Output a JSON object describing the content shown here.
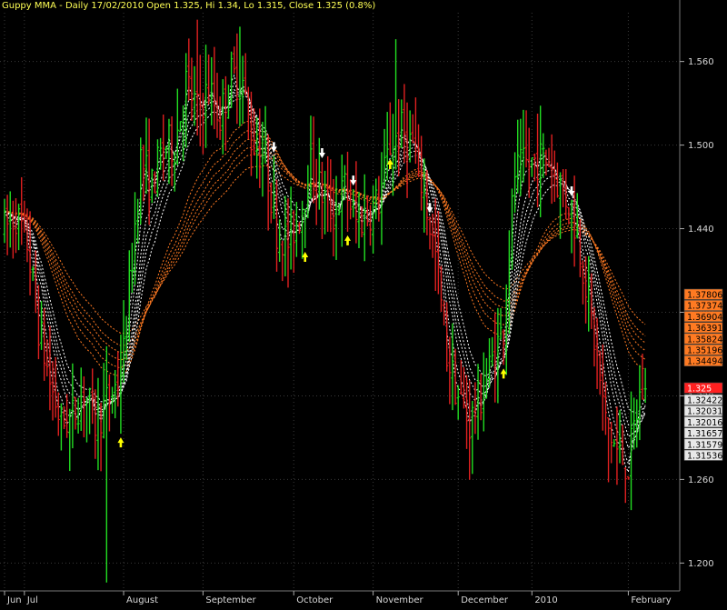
{
  "header": {
    "title": "Guppy MMA - Daily 17/02/2010 Open 1.325, Hi 1.34, Lo 1.315, Close 1.325 (0.8%)"
  },
  "colors": {
    "background": "#000000",
    "up_bar": "#22dd22",
    "down_bar": "#e02020",
    "short_ema": "#ffffff",
    "long_ema": "#ff7a22",
    "buy_arrow": "#ffff00",
    "sell_arrow": "#ffffff",
    "grid": "#3a3a3a",
    "long_label_bg": "#ff7a22",
    "short_label_bg": "#e8e8e8",
    "price_label_bg": "#ff2020"
  },
  "chart_data": {
    "type": "ohlc",
    "title": "Guppy MMA - Daily 17/02/2010 Open 1.325, Hi 1.34, Lo 1.315, Close 1.325 (0.8%)",
    "xlabel": "",
    "ylabel": "",
    "ylim": [
      1.18,
      1.595
    ],
    "y_ticks": [
      1.2,
      1.26,
      1.32,
      1.38,
      1.44,
      1.5,
      1.56
    ],
    "y_tick_labels": [
      "1.200",
      "1.260",
      "1.320",
      "1.380",
      "1.440",
      "1.500",
      "1.560"
    ],
    "x_tick_labels": [
      "Jun",
      "Jul",
      "August",
      "September",
      "October",
      "November",
      "December",
      "2010",
      "February"
    ],
    "x_tick_label_days": [
      0,
      7,
      42,
      70,
      102,
      130,
      160,
      186,
      220
    ],
    "grid": true,
    "trend_points": [
      [
        0,
        1.44
      ],
      [
        4,
        1.45
      ],
      [
        8,
        1.43
      ],
      [
        12,
        1.37
      ],
      [
        16,
        1.33
      ],
      [
        20,
        1.3
      ],
      [
        24,
        1.305
      ],
      [
        28,
        1.325
      ],
      [
        32,
        1.3
      ],
      [
        36,
        1.315
      ],
      [
        40,
        1.33
      ],
      [
        42,
        1.35
      ],
      [
        45,
        1.42
      ],
      [
        48,
        1.49
      ],
      [
        52,
        1.47
      ],
      [
        56,
        1.5
      ],
      [
        60,
        1.5
      ],
      [
        64,
        1.545
      ],
      [
        68,
        1.525
      ],
      [
        72,
        1.54
      ],
      [
        76,
        1.52
      ],
      [
        80,
        1.55
      ],
      [
        84,
        1.545
      ],
      [
        87,
        1.505
      ],
      [
        92,
        1.49
      ],
      [
        96,
        1.44
      ],
      [
        100,
        1.43
      ],
      [
        104,
        1.45
      ],
      [
        108,
        1.485
      ],
      [
        112,
        1.465
      ],
      [
        116,
        1.45
      ],
      [
        120,
        1.47
      ],
      [
        124,
        1.445
      ],
      [
        128,
        1.45
      ],
      [
        132,
        1.46
      ],
      [
        136,
        1.5
      ],
      [
        140,
        1.51
      ],
      [
        144,
        1.5
      ],
      [
        148,
        1.465
      ],
      [
        152,
        1.42
      ],
      [
        156,
        1.35
      ],
      [
        160,
        1.32
      ],
      [
        164,
        1.3
      ],
      [
        168,
        1.32
      ],
      [
        172,
        1.345
      ],
      [
        176,
        1.37
      ],
      [
        180,
        1.48
      ],
      [
        184,
        1.485
      ],
      [
        188,
        1.49
      ],
      [
        192,
        1.49
      ],
      [
        196,
        1.47
      ],
      [
        200,
        1.455
      ],
      [
        204,
        1.415
      ],
      [
        208,
        1.36
      ],
      [
        212,
        1.3
      ],
      [
        216,
        1.28
      ],
      [
        220,
        1.27
      ],
      [
        224,
        1.32
      ],
      [
        226,
        1.325
      ]
    ],
    "short_ema_periods": [
      3,
      5,
      8,
      10,
      12,
      15
    ],
    "long_ema_periods": [
      30,
      35,
      40,
      45,
      50,
      60
    ],
    "last_bar": {
      "open": 1.325,
      "high": 1.34,
      "low": 1.315,
      "close": 1.325,
      "change_pct": 0.8
    },
    "buy_signal_days": [
      41,
      106,
      121,
      136,
      176
    ],
    "sell_signal_days": [
      95,
      112,
      123,
      150,
      200
    ],
    "long_ema_end_values": [
      1.37806,
      1.37374,
      1.36904,
      1.36391,
      1.35824,
      1.35196,
      1.34494
    ],
    "long_ema_end_labels": [
      "1.37806",
      "1.37374",
      "1.36904",
      "1.36391",
      "1.35824",
      "1.35196",
      "1.34494"
    ],
    "price_end_value": 1.325,
    "price_end_label": "1.325",
    "short_ema_end_values": [
      1.32422,
      1.32031,
      1.32016,
      1.31657,
      1.31579,
      1.31536
    ],
    "short_ema_end_labels": [
      "1.32422",
      "1.32031",
      "1.32016",
      "1.31657",
      "1.31579",
      "1.31536"
    ]
  }
}
